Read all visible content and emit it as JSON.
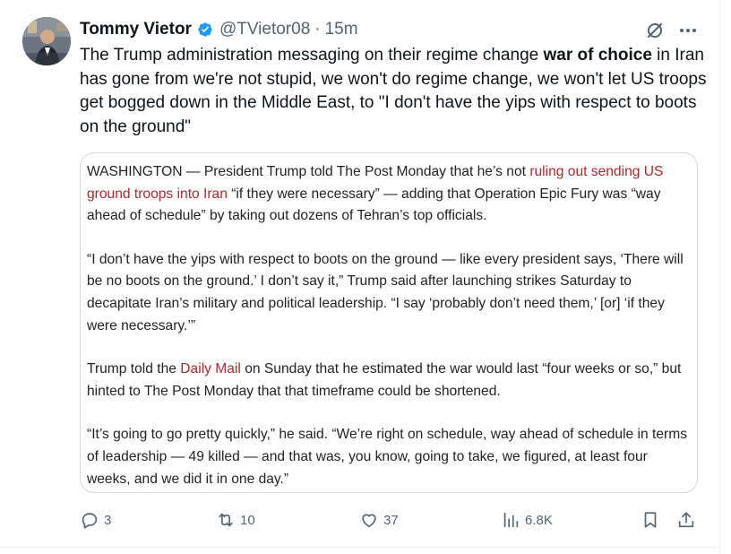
{
  "tweet": {
    "author_name": "Tommy Vietor",
    "handle": "@TVietor08",
    "separator": "·",
    "time": "15m",
    "text_before": "The Trump administration messaging on their regime change ",
    "text_bold": "war of choice",
    "text_after": " in Iran has gone from we're not stupid, we won't do regime change, we won't let US troops get bogged down in the Middle East, to \"I don't have the yips with respect to boots on the ground\""
  },
  "quote": {
    "p1_a": "WASHINGTON — President Trump told The Post Monday that he’s not ",
    "p1_link": "ruling out sending US ground troops into Iran",
    "p1_b": " “if they were necessary” — adding that Operation Epic Fury was “way ahead of schedule” by taking out dozens of Tehran’s top officials.",
    "p2": "“I don’t have the yips with respect to boots on the ground — like every president says, ‘There will be no boots on the ground.’ I don’t say it,” Trump said after launching strikes Saturday to decapitate Iran’s military and political leadership. “I say ‘probably don’t need them,’ [or] ‘if they were necessary.’”",
    "p3_a": "Trump told the ",
    "p3_link": "Daily Mail",
    "p3_b": " on Sunday that he estimated the war would last “four weeks or so,” but hinted to The Post Monday that that timeframe could be shortened.",
    "p4": "“It’s going to go pretty quickly,” he said. “We’re right on schedule, way ahead of schedule in terms of leadership — 49 killed — and that was, you know, going to take, we figured, at least four weeks, and we did it in one day.”"
  },
  "actions": {
    "replies": "3",
    "reposts": "10",
    "likes": "37",
    "views": "6.8K"
  },
  "icons": {
    "verified": "verified-badge-icon",
    "grok": "grok-icon",
    "more": "more-icon",
    "reply": "reply-icon",
    "repost": "repost-icon",
    "like": "like-icon",
    "views": "views-icon",
    "bookmark": "bookmark-icon",
    "share": "share-icon"
  },
  "colors": {
    "verified_blue": "#1d9bf0",
    "link_red": "#b3272d",
    "secondary_text": "#536471"
  }
}
